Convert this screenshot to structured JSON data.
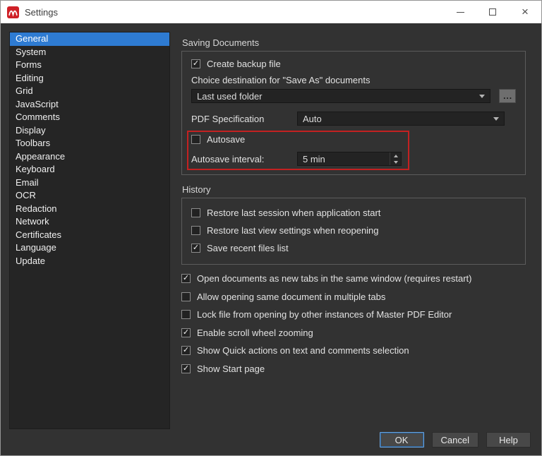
{
  "window": {
    "title": "Settings"
  },
  "icons": {
    "app_logo": "red-rounded-square-with-white-m-swoosh",
    "minimize": "css-horizontal-line",
    "maximize": "css-square-outline",
    "close": "×",
    "check": "✓",
    "dropdown_arrow": "css-triangle-down",
    "spin_up": "css-triangle-up",
    "spin_down": "css-triangle-down"
  },
  "sidebar": {
    "selected_index": 0,
    "items": [
      "General",
      "System",
      "Forms",
      "Editing",
      "Grid",
      "JavaScript",
      "Comments",
      "Display",
      "Toolbars",
      "Appearance",
      "Keyboard",
      "Email",
      "OCR",
      "Redaction",
      "Network",
      "Certificates",
      "Language",
      "Update"
    ]
  },
  "saving_documents": {
    "group_title": "Saving Documents",
    "create_backup": {
      "label": "Create backup file",
      "checked": true
    },
    "save_as_destination_label": "Choice destination for \"Save As\" documents",
    "save_as_destination_value": "Last used folder",
    "browse_label": "...",
    "pdf_spec_label": "PDF Specification",
    "pdf_spec_value": "Auto",
    "autosave": {
      "label": "Autosave",
      "checked": false
    },
    "autosave_interval_label": "Autosave interval:",
    "autosave_interval_value": "5 min"
  },
  "history": {
    "group_title": "History",
    "items": [
      {
        "label": "Restore last session when application start",
        "checked": false
      },
      {
        "label": "Restore last view settings when reopening",
        "checked": false
      },
      {
        "label": "Save recent files list",
        "checked": true
      }
    ]
  },
  "general_options": [
    {
      "label": "Open documents as new tabs in the same window (requires restart)",
      "checked": true
    },
    {
      "label": "Allow opening same document in multiple tabs",
      "checked": false
    },
    {
      "label": "Lock file from opening by other instances of Master PDF Editor",
      "checked": false
    },
    {
      "label": "Enable scroll wheel zooming",
      "checked": true
    },
    {
      "label": "Show Quick actions on text and comments selection",
      "checked": true
    },
    {
      "label": "Show Start page",
      "checked": true
    }
  ],
  "footer": {
    "ok": "OK",
    "cancel": "Cancel",
    "help": "Help"
  },
  "colors": {
    "accent_blue": "#2e7bd2",
    "annotation_red": "#c32121",
    "titlebar_bg": "#ffffff",
    "body_bg": "#323232",
    "sidebar_bg": "#252525",
    "logo_red": "#cf2027"
  }
}
